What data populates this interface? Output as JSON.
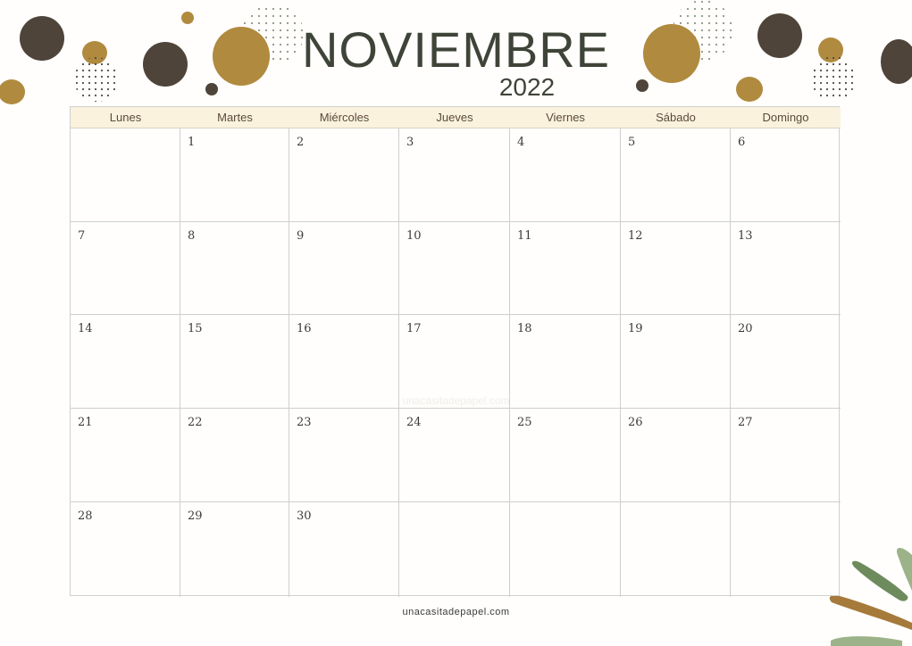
{
  "header": {
    "month": "NOVIEMBRE",
    "year": "2022"
  },
  "weekdays": [
    "Lunes",
    "Martes",
    "Miércoles",
    "Jueves",
    "Viernes",
    "Sábado",
    "Domingo"
  ],
  "weeks": [
    [
      "",
      "1",
      "2",
      "3",
      "4",
      "5",
      "6"
    ],
    [
      "7",
      "8",
      "9",
      "10",
      "11",
      "12",
      "13"
    ],
    [
      "14",
      "15",
      "16",
      "17",
      "18",
      "19",
      "20"
    ],
    [
      "21",
      "22",
      "23",
      "24",
      "25",
      "26",
      "27"
    ],
    [
      "28",
      "29",
      "30",
      "",
      "",
      "",
      ""
    ]
  ],
  "watermark": "unacasitadepapel.com",
  "footer": "unacasitadepapel.com",
  "colors": {
    "title": "#3f4438",
    "header_band": "#fbf2dd",
    "dark_blob": "#4e443a",
    "gold_blob": "#b08a3e",
    "leaf_green": "#6d8b5c",
    "leaf_light": "#9cb38a"
  }
}
